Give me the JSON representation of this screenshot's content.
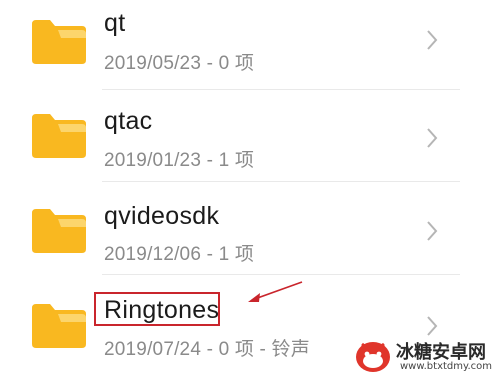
{
  "files": [
    {
      "name": "qt",
      "meta": "2019/05/23 - 0 项",
      "icon": "folder-icon"
    },
    {
      "name": "qtac",
      "meta": "2019/01/23 - 1 项",
      "icon": "folder-icon"
    },
    {
      "name": "qvideosdk",
      "meta": "2019/12/06 - 1 项",
      "icon": "folder-icon"
    },
    {
      "name": "Ringtones",
      "meta": "2019/07/24 - 0 项 - 铃声",
      "icon": "folder-icon"
    }
  ],
  "watermark": {
    "title": "冰糖安卓网",
    "url": "www.btxtdmy.com"
  },
  "colors": {
    "folder": "#f9b820",
    "folder_tab": "#fcd56c",
    "annotation": "#c9252c",
    "text_primary": "#1b1b1b",
    "text_secondary": "#8a8a8a"
  }
}
